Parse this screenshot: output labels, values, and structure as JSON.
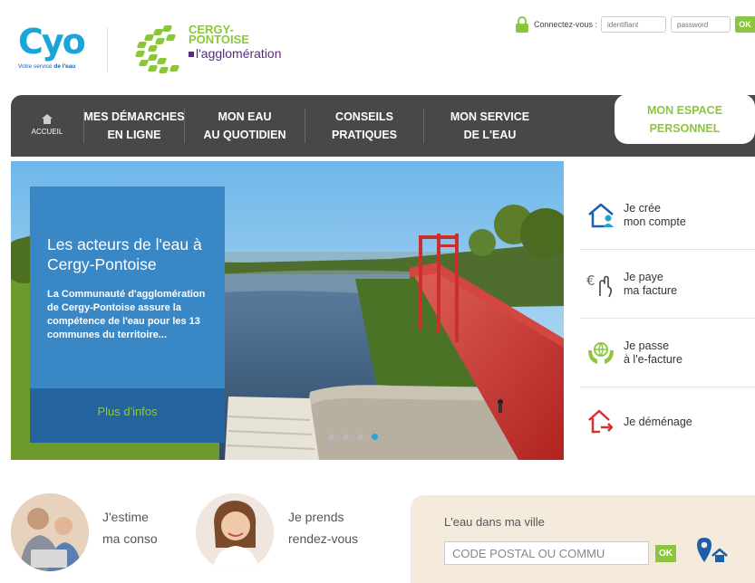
{
  "header": {
    "logo_cyo_mark": "Cyo",
    "logo_cyo_tagline_a": "Votre service",
    "logo_cyo_tagline_b": "de l'eau",
    "logo_cp_line1": "CERGY-",
    "logo_cp_line2": "PONTOISE",
    "logo_cp_line3": "l'agglomération"
  },
  "login": {
    "label": "Connectez-vous :",
    "id_placeholder": "identifiant",
    "pw_placeholder": "password",
    "ok": "OK"
  },
  "nav": {
    "home": "ACCUEIL",
    "items": [
      {
        "line1": "MES DÉMARCHES",
        "line2": "EN LIGNE"
      },
      {
        "line1": "MON EAU",
        "line2": "AU QUOTIDIEN"
      },
      {
        "line1": "CONSEILS",
        "line2": "PRATIQUES"
      },
      {
        "line1": "MON SERVICE",
        "line2": "DE L'EAU"
      }
    ],
    "espace_line1": "MON ESPACE",
    "espace_line2": "PERSONNEL"
  },
  "hero": {
    "title": "Les acteurs de l'eau à Cergy-Pontoise",
    "description": "La Communauté d'agglomération de Cergy-Pontoise assure la compétence de l'eau pour les 13 communes du territoire...",
    "more": "Plus d'infos",
    "slides": 4,
    "active_slide": 4
  },
  "actions": [
    {
      "icon": "house-user-icon",
      "line1": "Je crée",
      "line2": "mon compte"
    },
    {
      "icon": "euro-hand-icon",
      "line1": "Je paye",
      "line2": "ma facture"
    },
    {
      "icon": "globe-hands-icon",
      "line1": "Je passe",
      "line2": "à l'e-facture"
    },
    {
      "icon": "house-move-icon",
      "line1": "Je déménage",
      "line2": ""
    }
  ],
  "bottom": {
    "conso_line1": "J'estime",
    "conso_line2": "ma conso",
    "rdv_line1": "Je prends",
    "rdv_line2": "rendez-vous",
    "ville_title": "L'eau dans ma ville",
    "ville_value": "CODE POSTAL OU COMMU",
    "ville_ok": "OK"
  },
  "colors": {
    "brand_green": "#8cc63f",
    "brand_blue": "#3a87c6",
    "nav_bg": "#4a4747"
  }
}
